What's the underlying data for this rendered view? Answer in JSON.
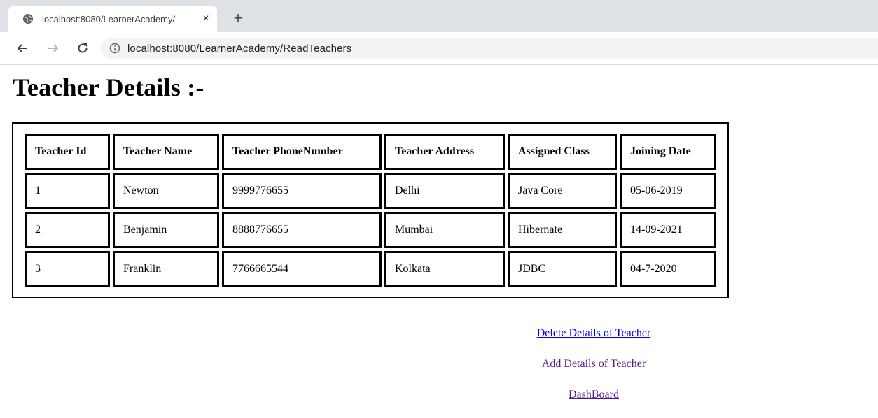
{
  "browser": {
    "tab_title": "localhost:8080/LearnerAcademy/",
    "tab_close": "×",
    "new_tab": "+",
    "url": "localhost:8080/LearnerAcademy/ReadTeachers"
  },
  "page": {
    "title": "Teacher Details :-"
  },
  "table": {
    "headers": [
      "Teacher Id",
      "Teacher Name",
      "Teacher PhoneNumber",
      "Teacher Address",
      "Assigned Class",
      "Joining Date"
    ],
    "rows": [
      [
        "1",
        "Newton",
        "9999776655",
        "Delhi",
        "Java Core",
        "05-06-2019"
      ],
      [
        "2",
        "Benjamin",
        "8888776655",
        "Mumbai",
        "Hibernate",
        "14-09-2021"
      ],
      [
        "3",
        "Franklin",
        "7766665544",
        "Kolkata",
        "JDBC",
        "04-7-2020"
      ]
    ]
  },
  "links": {
    "delete": "Delete Details of Teacher",
    "add": "Add Details of Teacher",
    "dashboard": "DashBoard"
  },
  "colors": {
    "link_unvisited": "#0000ee",
    "link_visited": "#551a8b",
    "tabstrip": "#dee1e6"
  }
}
